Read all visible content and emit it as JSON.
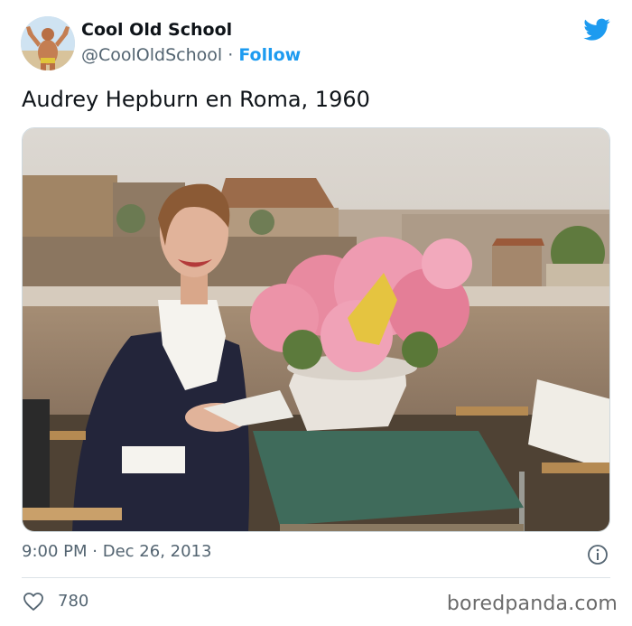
{
  "tweet": {
    "display_name": "Cool Old School",
    "handle": "@CoolOldSchool",
    "separator": "·",
    "follow_label": "Follow",
    "text": "Audrey Hepburn en Roma, 1960",
    "time": "9:00 PM",
    "date": "Dec 26, 2013",
    "like_count": "780"
  },
  "icons": {
    "brand": "twitter-bird-icon",
    "info": "info-icon",
    "like": "heart-icon"
  },
  "colors": {
    "accent": "#1d9bf0",
    "text": "#0f1419",
    "muted": "#536471"
  },
  "watermark": "boredpanda.com"
}
